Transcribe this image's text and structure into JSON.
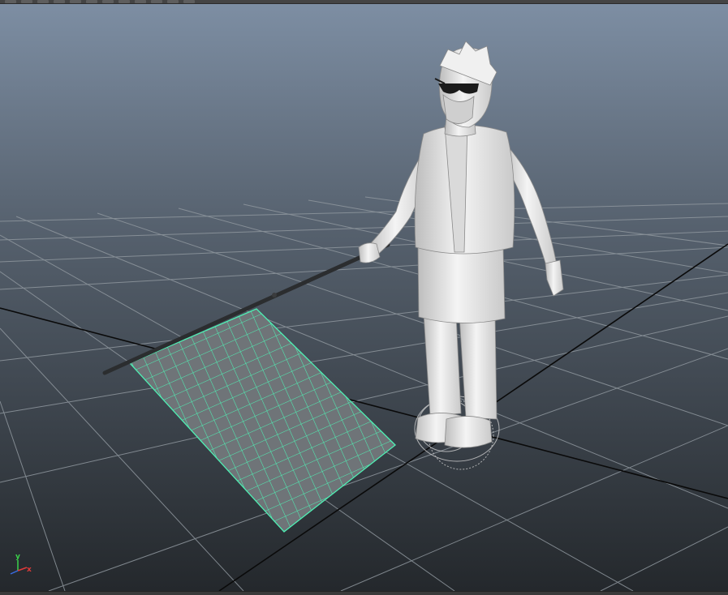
{
  "toolbar": {
    "buttons": [
      "icon-tool-1",
      "icon-tool-2",
      "icon-tool-3",
      "icon-tool-4",
      "icon-tool-5",
      "icon-tool-6",
      "icon-tool-7",
      "icon-tool-8",
      "icon-tool-9",
      "icon-tool-10",
      "icon-tool-11",
      "icon-tool-12"
    ]
  },
  "viewport": {
    "axis_gizmo": {
      "y_label": "y",
      "x_label": "x"
    },
    "colors": {
      "background_top": "#7d8ea3",
      "background_bottom": "#24282c",
      "grid": "#8f979e",
      "axis_line": "#0a0a0a",
      "cloth_fill": "#6f7478",
      "cloth_wire": "#4ff0b4",
      "character": "#e2e2e2"
    },
    "objects": [
      "character",
      "flag-pole",
      "cloth-mesh",
      "locator-control"
    ]
  }
}
